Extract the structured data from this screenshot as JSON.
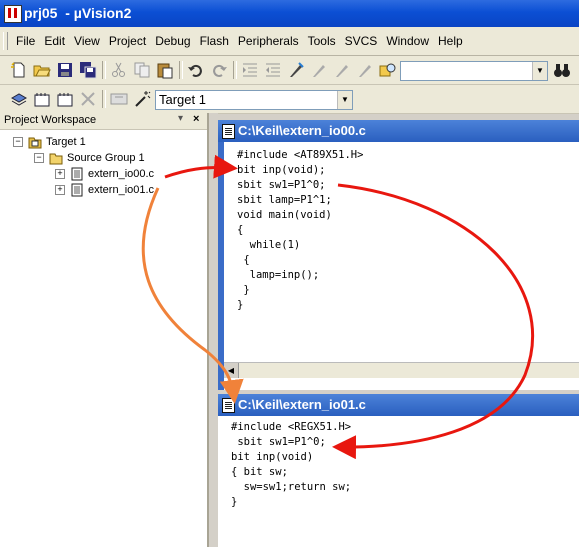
{
  "window": {
    "title": "prj05  - µVision2"
  },
  "menu": [
    "File",
    "Edit",
    "View",
    "Project",
    "Debug",
    "Flash",
    "Peripherals",
    "Tools",
    "SVCS",
    "Window",
    "Help"
  ],
  "toolbar": {
    "find_value": "",
    "target_value": "Target 1"
  },
  "workspace": {
    "title": "Project Workspace",
    "tree": {
      "target": "Target 1",
      "group": "Source Group 1",
      "files": [
        "extern_io00.c",
        "extern_io01.c"
      ]
    }
  },
  "editor1": {
    "title": "C:\\Keil\\extern_io00.c",
    "lines": [
      "#include <AT89X51.H>",
      "bit inp(void);",
      "sbit sw1=P1^0;",
      "sbit lamp=P1^1;",
      "void main(void)",
      "{",
      "  while(1)",
      " {",
      "  lamp=inp();",
      " }",
      "}"
    ]
  },
  "editor2": {
    "title": "C:\\Keil\\extern_io01.c",
    "lines": [
      "#include <REGX51.H>",
      " sbit sw1=P1^0;",
      "bit inp(void)",
      "{ bit sw;",
      "  sw=sw1;return sw;",
      "}"
    ]
  },
  "annotation_colors": {
    "red": "#e8170f",
    "orange": "#f0823a"
  }
}
